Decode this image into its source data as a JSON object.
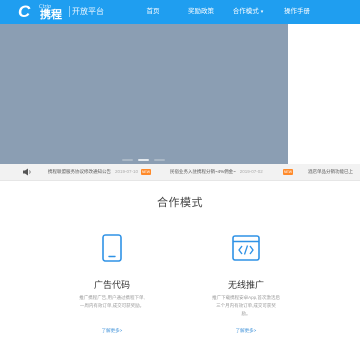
{
  "header": {
    "logo_mark": "C",
    "logo_sub": "Ctrip",
    "logo_cn": "携程",
    "platform": "开放平台",
    "nav": [
      {
        "label": "首页",
        "has_caret": false
      },
      {
        "label": "奖励政策",
        "has_caret": false
      },
      {
        "label": "合作模式",
        "has_caret": true
      },
      {
        "label": "操作手册",
        "has_caret": false
      }
    ],
    "caret_glyph": "▾"
  },
  "notices": [
    {
      "text": "携程联盟服务协议修改通知公告",
      "date": "2019-07-10",
      "badge": "NEW"
    },
    {
      "text": "民宿业务入驻携程分销~4%佣金~",
      "date": "2019-07-02",
      "badge": "NEW"
    },
    {
      "text": "酒店单品分销功能已上"
    }
  ],
  "section": {
    "title": "合作模式",
    "modes": [
      {
        "title": "广告代码",
        "desc": "推广携程广告,用户通过携程下单,一周内有效订单,成交可获奖励。",
        "link": "了解更多>",
        "icon": "mobile-phone-icon"
      },
      {
        "title": "无线推广",
        "desc": "推广下载携程安卓App,首次激活后三个月内有效订单,成交可获奖励。",
        "link": "了解更多>",
        "icon": "code-window-icon"
      }
    ]
  },
  "colors": {
    "header_bg": "#1f9ef0",
    "banner_bg": "#8b9eb3",
    "icon_blue": "#2f92e6",
    "badge_orange": "#ff8a2a",
    "link_blue": "#3b8fd8"
  }
}
